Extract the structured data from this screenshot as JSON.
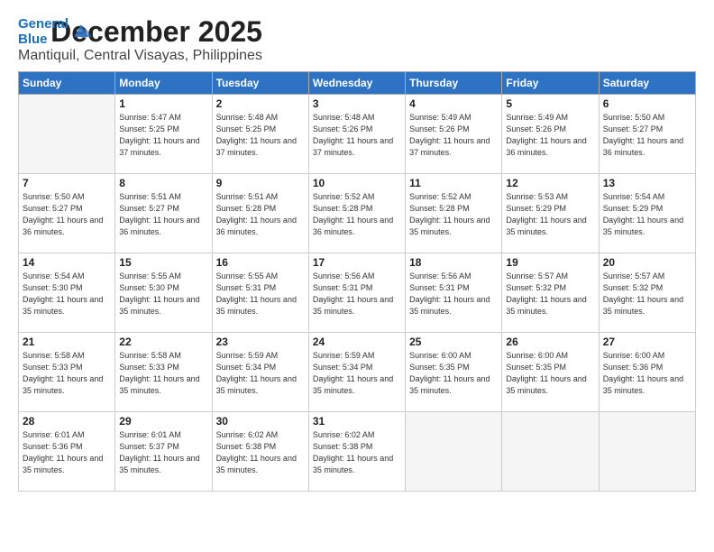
{
  "logo": {
    "line1": "General",
    "line2": "Blue"
  },
  "header": {
    "month": "December 2025",
    "location": "Mantiquil, Central Visayas, Philippines"
  },
  "weekdays": [
    "Sunday",
    "Monday",
    "Tuesday",
    "Wednesday",
    "Thursday",
    "Friday",
    "Saturday"
  ],
  "weeks": [
    [
      {
        "day": "",
        "sunrise": "",
        "sunset": "",
        "daylight": ""
      },
      {
        "day": "1",
        "sunrise": "Sunrise: 5:47 AM",
        "sunset": "Sunset: 5:25 PM",
        "daylight": "Daylight: 11 hours and 37 minutes."
      },
      {
        "day": "2",
        "sunrise": "Sunrise: 5:48 AM",
        "sunset": "Sunset: 5:25 PM",
        "daylight": "Daylight: 11 hours and 37 minutes."
      },
      {
        "day": "3",
        "sunrise": "Sunrise: 5:48 AM",
        "sunset": "Sunset: 5:26 PM",
        "daylight": "Daylight: 11 hours and 37 minutes."
      },
      {
        "day": "4",
        "sunrise": "Sunrise: 5:49 AM",
        "sunset": "Sunset: 5:26 PM",
        "daylight": "Daylight: 11 hours and 37 minutes."
      },
      {
        "day": "5",
        "sunrise": "Sunrise: 5:49 AM",
        "sunset": "Sunset: 5:26 PM",
        "daylight": "Daylight: 11 hours and 36 minutes."
      },
      {
        "day": "6",
        "sunrise": "Sunrise: 5:50 AM",
        "sunset": "Sunset: 5:27 PM",
        "daylight": "Daylight: 11 hours and 36 minutes."
      }
    ],
    [
      {
        "day": "7",
        "sunrise": "Sunrise: 5:50 AM",
        "sunset": "Sunset: 5:27 PM",
        "daylight": "Daylight: 11 hours and 36 minutes."
      },
      {
        "day": "8",
        "sunrise": "Sunrise: 5:51 AM",
        "sunset": "Sunset: 5:27 PM",
        "daylight": "Daylight: 11 hours and 36 minutes."
      },
      {
        "day": "9",
        "sunrise": "Sunrise: 5:51 AM",
        "sunset": "Sunset: 5:28 PM",
        "daylight": "Daylight: 11 hours and 36 minutes."
      },
      {
        "day": "10",
        "sunrise": "Sunrise: 5:52 AM",
        "sunset": "Sunset: 5:28 PM",
        "daylight": "Daylight: 11 hours and 36 minutes."
      },
      {
        "day": "11",
        "sunrise": "Sunrise: 5:52 AM",
        "sunset": "Sunset: 5:28 PM",
        "daylight": "Daylight: 11 hours and 35 minutes."
      },
      {
        "day": "12",
        "sunrise": "Sunrise: 5:53 AM",
        "sunset": "Sunset: 5:29 PM",
        "daylight": "Daylight: 11 hours and 35 minutes."
      },
      {
        "day": "13",
        "sunrise": "Sunrise: 5:54 AM",
        "sunset": "Sunset: 5:29 PM",
        "daylight": "Daylight: 11 hours and 35 minutes."
      }
    ],
    [
      {
        "day": "14",
        "sunrise": "Sunrise: 5:54 AM",
        "sunset": "Sunset: 5:30 PM",
        "daylight": "Daylight: 11 hours and 35 minutes."
      },
      {
        "day": "15",
        "sunrise": "Sunrise: 5:55 AM",
        "sunset": "Sunset: 5:30 PM",
        "daylight": "Daylight: 11 hours and 35 minutes."
      },
      {
        "day": "16",
        "sunrise": "Sunrise: 5:55 AM",
        "sunset": "Sunset: 5:31 PM",
        "daylight": "Daylight: 11 hours and 35 minutes."
      },
      {
        "day": "17",
        "sunrise": "Sunrise: 5:56 AM",
        "sunset": "Sunset: 5:31 PM",
        "daylight": "Daylight: 11 hours and 35 minutes."
      },
      {
        "day": "18",
        "sunrise": "Sunrise: 5:56 AM",
        "sunset": "Sunset: 5:31 PM",
        "daylight": "Daylight: 11 hours and 35 minutes."
      },
      {
        "day": "19",
        "sunrise": "Sunrise: 5:57 AM",
        "sunset": "Sunset: 5:32 PM",
        "daylight": "Daylight: 11 hours and 35 minutes."
      },
      {
        "day": "20",
        "sunrise": "Sunrise: 5:57 AM",
        "sunset": "Sunset: 5:32 PM",
        "daylight": "Daylight: 11 hours and 35 minutes."
      }
    ],
    [
      {
        "day": "21",
        "sunrise": "Sunrise: 5:58 AM",
        "sunset": "Sunset: 5:33 PM",
        "daylight": "Daylight: 11 hours and 35 minutes."
      },
      {
        "day": "22",
        "sunrise": "Sunrise: 5:58 AM",
        "sunset": "Sunset: 5:33 PM",
        "daylight": "Daylight: 11 hours and 35 minutes."
      },
      {
        "day": "23",
        "sunrise": "Sunrise: 5:59 AM",
        "sunset": "Sunset: 5:34 PM",
        "daylight": "Daylight: 11 hours and 35 minutes."
      },
      {
        "day": "24",
        "sunrise": "Sunrise: 5:59 AM",
        "sunset": "Sunset: 5:34 PM",
        "daylight": "Daylight: 11 hours and 35 minutes."
      },
      {
        "day": "25",
        "sunrise": "Sunrise: 6:00 AM",
        "sunset": "Sunset: 5:35 PM",
        "daylight": "Daylight: 11 hours and 35 minutes."
      },
      {
        "day": "26",
        "sunrise": "Sunrise: 6:00 AM",
        "sunset": "Sunset: 5:35 PM",
        "daylight": "Daylight: 11 hours and 35 minutes."
      },
      {
        "day": "27",
        "sunrise": "Sunrise: 6:00 AM",
        "sunset": "Sunset: 5:36 PM",
        "daylight": "Daylight: 11 hours and 35 minutes."
      }
    ],
    [
      {
        "day": "28",
        "sunrise": "Sunrise: 6:01 AM",
        "sunset": "Sunset: 5:36 PM",
        "daylight": "Daylight: 11 hours and 35 minutes."
      },
      {
        "day": "29",
        "sunrise": "Sunrise: 6:01 AM",
        "sunset": "Sunset: 5:37 PM",
        "daylight": "Daylight: 11 hours and 35 minutes."
      },
      {
        "day": "30",
        "sunrise": "Sunrise: 6:02 AM",
        "sunset": "Sunset: 5:38 PM",
        "daylight": "Daylight: 11 hours and 35 minutes."
      },
      {
        "day": "31",
        "sunrise": "Sunrise: 6:02 AM",
        "sunset": "Sunset: 5:38 PM",
        "daylight": "Daylight: 11 hours and 35 minutes."
      },
      {
        "day": "",
        "sunrise": "",
        "sunset": "",
        "daylight": ""
      },
      {
        "day": "",
        "sunrise": "",
        "sunset": "",
        "daylight": ""
      },
      {
        "day": "",
        "sunrise": "",
        "sunset": "",
        "daylight": ""
      }
    ]
  ]
}
